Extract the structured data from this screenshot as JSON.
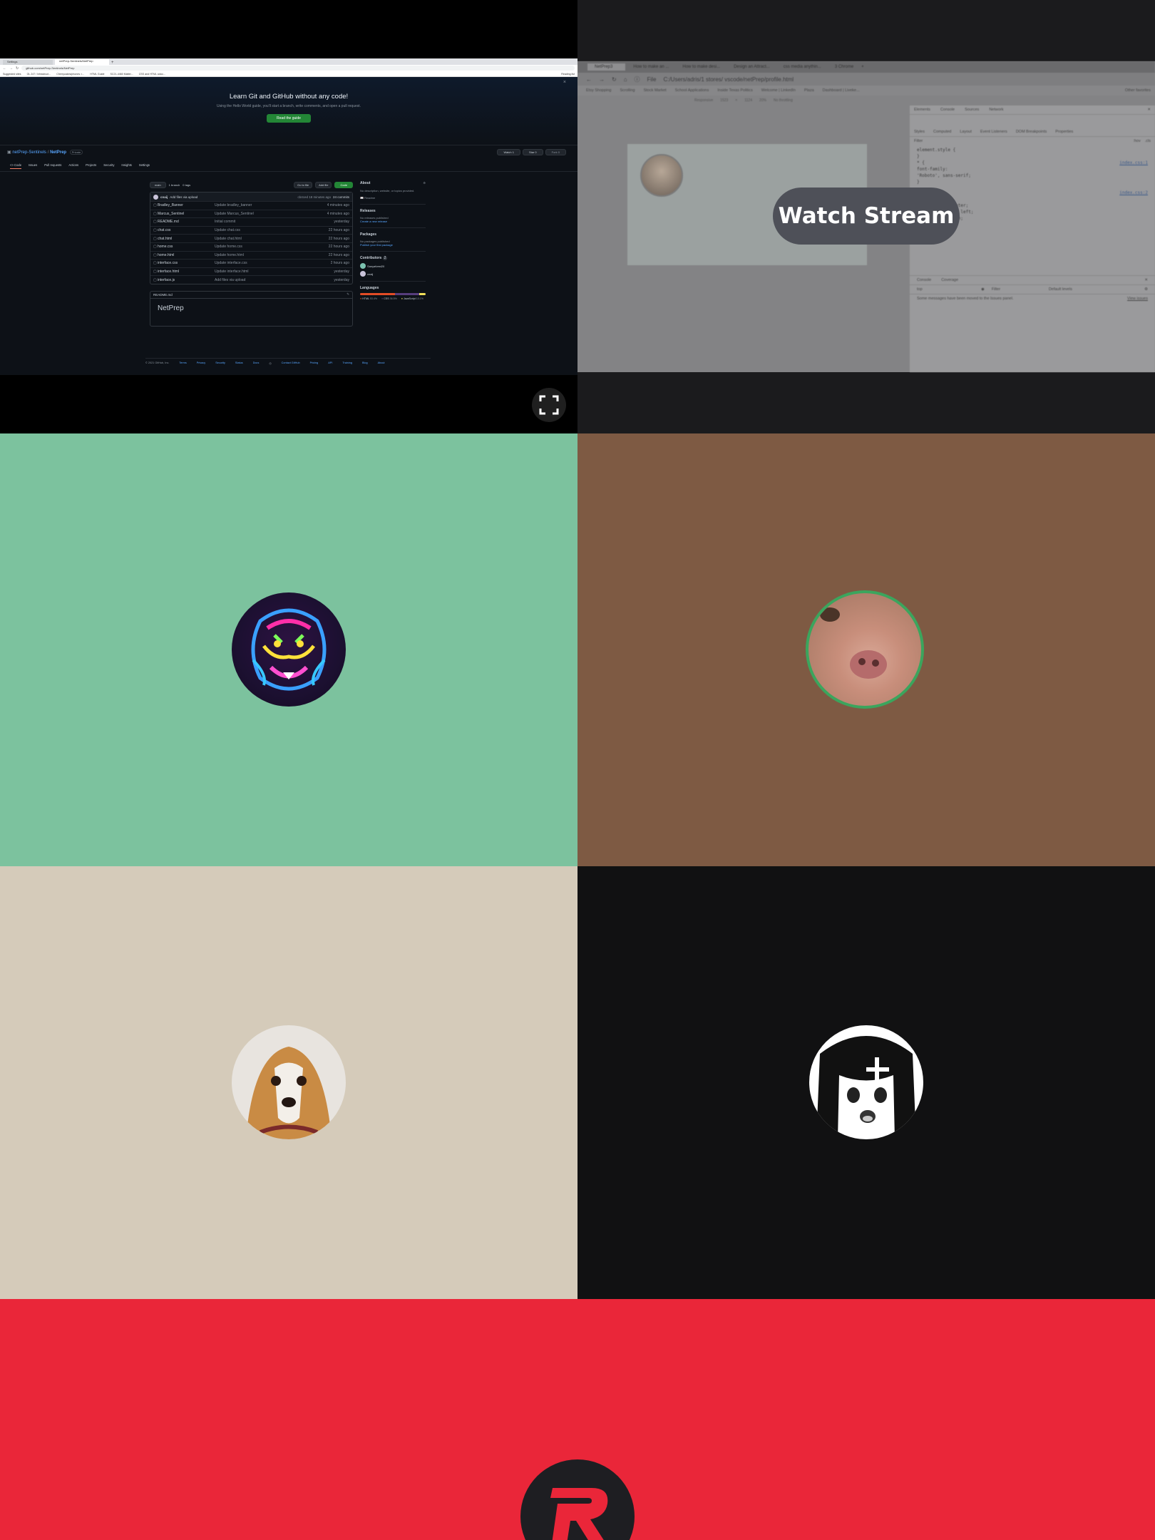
{
  "tiles": {
    "colors": {
      "green": "#7cc29e",
      "brown": "#7e5a43",
      "beige": "#d5cbba",
      "dark": "#111112",
      "red": "#ea2639"
    },
    "watch_stream_label": "Watch Stream",
    "fullscreen_icon": "fullscreen-icon"
  },
  "browser1": {
    "tabs": [
      "Settings",
      "netPrep-Sentinels/NetPrep"
    ],
    "url": "github.com/netPrep-Sentinels/NetPrep",
    "bookmarks": [
      "Suggested sites",
      "OL 247 / Infrastruct...",
      "Cherrycakes/phones >...",
      "HTML Guide",
      "SC21-4460 Matter...",
      "CSS and HTML coloc..."
    ],
    "bookmark_right": "Reading list"
  },
  "github": {
    "banner_title": "Learn Git and GitHub without any code!",
    "banner_text": "Using the Hello World guide, you'll start a branch, write comments, and open a pull request.",
    "banner_button": "Read the guide",
    "repo_owner": "netPrep-Sentinels",
    "repo_name": "NetPrep",
    "repo_visibility": "Private",
    "header_buttons": [
      "Watch 1",
      "Star 0",
      "Fork 0"
    ],
    "nav_tabs": [
      "<> Code",
      "Issues",
      "Pull requests",
      "Actions",
      "Projects",
      "Security",
      "Insights",
      "Settings"
    ],
    "branch_button": "main",
    "branches": "1 branch",
    "tags": "0 tags",
    "goto_file": "Go to file",
    "add_file": "Add file",
    "code_button": "Code",
    "commit_user": "cnaij",
    "commit_message": "Add files via upload",
    "commit_meta": "cb4ced 18 minutes ago",
    "commit_count": "24 commits",
    "files": [
      {
        "name": "Bradley_Banner",
        "message": "Update bradley_banner",
        "time": "4 minutes ago"
      },
      {
        "name": "Marcus_Sentinel",
        "message": "Update Marcus_Sentinel",
        "time": "4 minutes ago"
      },
      {
        "name": "README.md",
        "message": "Initial commit",
        "time": "yesterday"
      },
      {
        "name": "chat.css",
        "message": "Update chat.css",
        "time": "22 hours ago"
      },
      {
        "name": "chat.html",
        "message": "Update chat.html",
        "time": "22 hours ago"
      },
      {
        "name": "home.css",
        "message": "Update home.css",
        "time": "22 hours ago"
      },
      {
        "name": "home.html",
        "message": "Update home.html",
        "time": "22 hours ago"
      },
      {
        "name": "interface.css",
        "message": "Update interface.css",
        "time": "2 hours ago"
      },
      {
        "name": "interface.html",
        "message": "Update interface.html",
        "time": "yesterday"
      },
      {
        "name": "interface.js",
        "message": "Add files via upload",
        "time": "yesterday"
      }
    ],
    "readme_label": "README.md",
    "readme_title": "NetPrep",
    "about_title": "About",
    "about_text": "No description, website, or topics provided.",
    "about_readme": "Readme",
    "releases_title": "Releases",
    "releases_text": "No releases published",
    "releases_link": "Create a new release",
    "packages_title": "Packages",
    "packages_text": "No packages published",
    "packages_link": "Publish your first package",
    "contributors_title": "Contributors",
    "contributors_count": "2",
    "contributors": [
      "Sanyafvest20",
      "cnaij"
    ],
    "languages_title": "Languages",
    "languages": [
      {
        "name": "HTML",
        "percent": "53.4%",
        "color": "#e34c26",
        "share": 53.4
      },
      {
        "name": "CSS",
        "percent": "36.5%",
        "color": "#563d7c",
        "share": 36.5
      },
      {
        "name": "JavaScript",
        "percent": "10.1%",
        "color": "#f1e05a",
        "share": 10.1
      }
    ],
    "footer": [
      "© 2021 GitHub, Inc.",
      "Terms",
      "Privacy",
      "Security",
      "Status",
      "Docs",
      "Contact GitHub",
      "Pricing",
      "API",
      "Training",
      "Blog",
      "About"
    ]
  },
  "browser2": {
    "tabs": [
      "NetPrep3",
      "How to make an ...",
      "How to make desi...",
      "Design an Attract...",
      "css media anythin...",
      "3 Chrome"
    ],
    "path": "C:/Users/adris/1 stores/ vscode/netPrep/profile.html",
    "file_label": "File",
    "bookmarks": [
      "Etsy Shopping",
      "Scrolling",
      "Stock Market",
      "School Applications",
      "Inside Texas Politics",
      "Welcome | LinkedIn",
      "Plaza",
      "Dashboard | Liveke..."
    ],
    "bookmark_right": "Other favorites",
    "device_toolbar": [
      "Responsive",
      "1523",
      "×",
      "1124",
      "20%",
      "No throttling"
    ],
    "devtools_tabs": [
      "Elements",
      "Console",
      "Sources",
      "Network"
    ],
    "styles_tabs": [
      "Styles",
      "Computed",
      "Layout",
      "Event Listeners",
      "DOM Breakpoints",
      "Properties"
    ],
    "filter_placeholder": "Filter",
    "hov_cls": [
      ":hov",
      ".cls"
    ],
    "css_lines": [
      "element.style {",
      "}",
      "* {",
      "  font-family:",
      "    'Roboto', sans-serif;",
      "}",
      "display: flex;",
      "align-items: center;",
      "justify-content: left;",
      "min-height: 100vh;",
      "padding: 0 0px;"
    ],
    "style_links": [
      "index.css:1",
      "index.css:2"
    ],
    "console_tabs": [
      "Console",
      "Coverage"
    ],
    "console_top": "top",
    "console_filter": "Filter",
    "console_levels": "Default levels",
    "console_message": "Some messages have been moved to the Issues panel.",
    "console_view_issues": "View issues"
  }
}
